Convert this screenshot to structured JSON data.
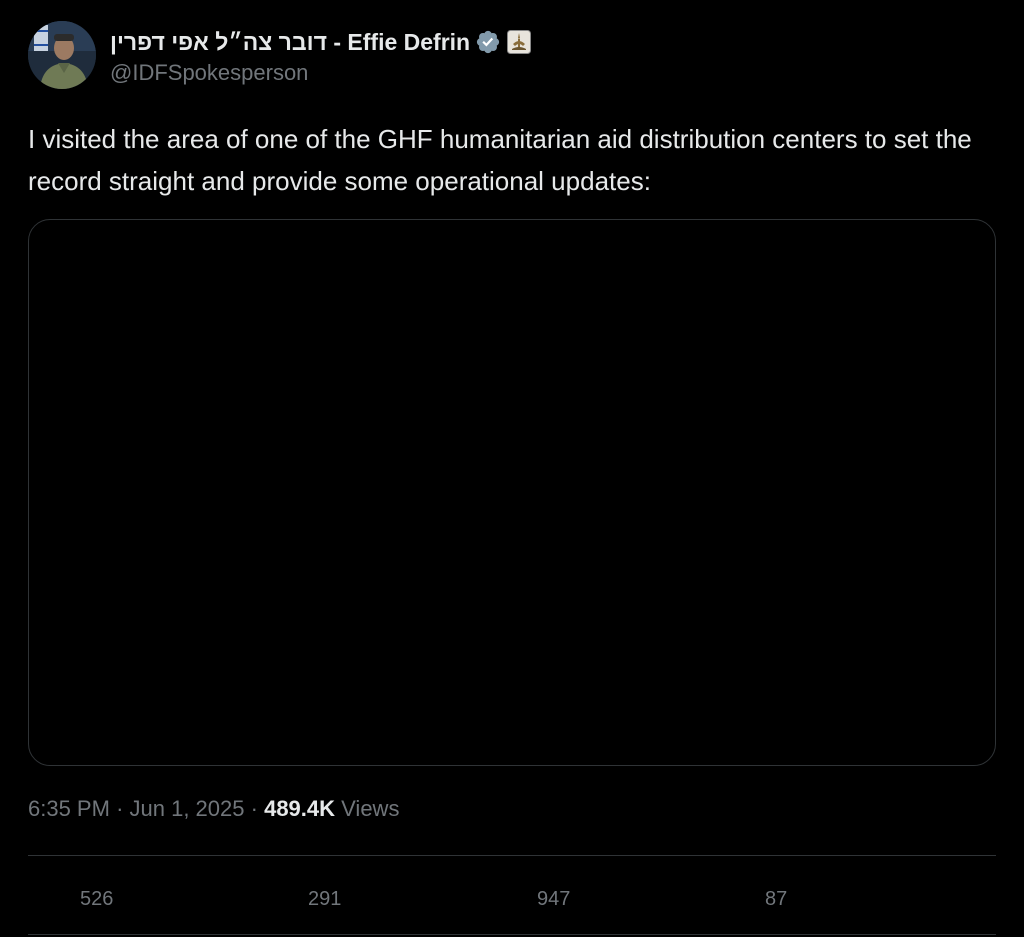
{
  "author": {
    "display_name": "דובר צה״ל אפי דפרין - Effie Defrin",
    "handle": "@IDFSpokesperson",
    "verified_icon": "verified-badge-icon",
    "affiliation_icon": "idf-emblem-icon"
  },
  "tweet": {
    "text": "I visited the area of one of the GHF humanitarian aid distribution centers to set the record straight and provide some operational updates:"
  },
  "meta": {
    "time": "6:35 PM",
    "separator": "·",
    "date": "Jun 1, 2025",
    "views_count": "489.4K",
    "views_label": "Views"
  },
  "actions": {
    "replies": "526",
    "reposts": "291",
    "likes": "947",
    "bookmarks": "87"
  },
  "colors": {
    "background": "#000000",
    "text_primary": "#e7e9ea",
    "text_secondary": "#71767b",
    "border": "#2f3336",
    "verified": "#829aab"
  }
}
